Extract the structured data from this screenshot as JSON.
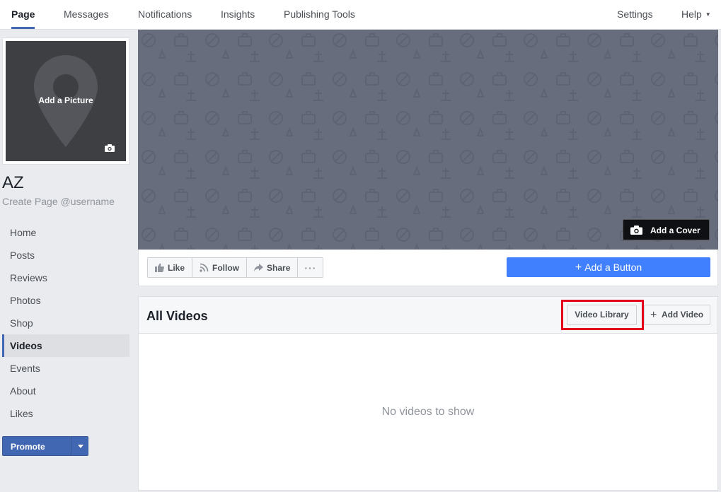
{
  "topnav": {
    "tabs": [
      "Page",
      "Messages",
      "Notifications",
      "Insights",
      "Publishing Tools"
    ],
    "settings": "Settings",
    "help": "Help"
  },
  "profile": {
    "add_picture": "Add a Picture",
    "name": "AZ",
    "username_link": "Create Page @username"
  },
  "sidebar": {
    "items": [
      "Home",
      "Posts",
      "Reviews",
      "Photos",
      "Shop",
      "Videos",
      "Events",
      "About",
      "Likes"
    ],
    "active": "Videos",
    "promote": "Promote"
  },
  "cover": {
    "add_cover": "Add a Cover",
    "color": "#686d7d"
  },
  "actions": {
    "like": "Like",
    "follow": "Follow",
    "share": "Share",
    "more": "···",
    "add_button": "Add a Button"
  },
  "videos": {
    "title": "All Videos",
    "library_button": "Video Library",
    "add_video_button": "Add Video",
    "empty_message": "No videos to show"
  },
  "colors": {
    "brand_blue": "#4267b2",
    "add_button_blue": "#4080ff",
    "highlight_red": "#e4001b"
  }
}
